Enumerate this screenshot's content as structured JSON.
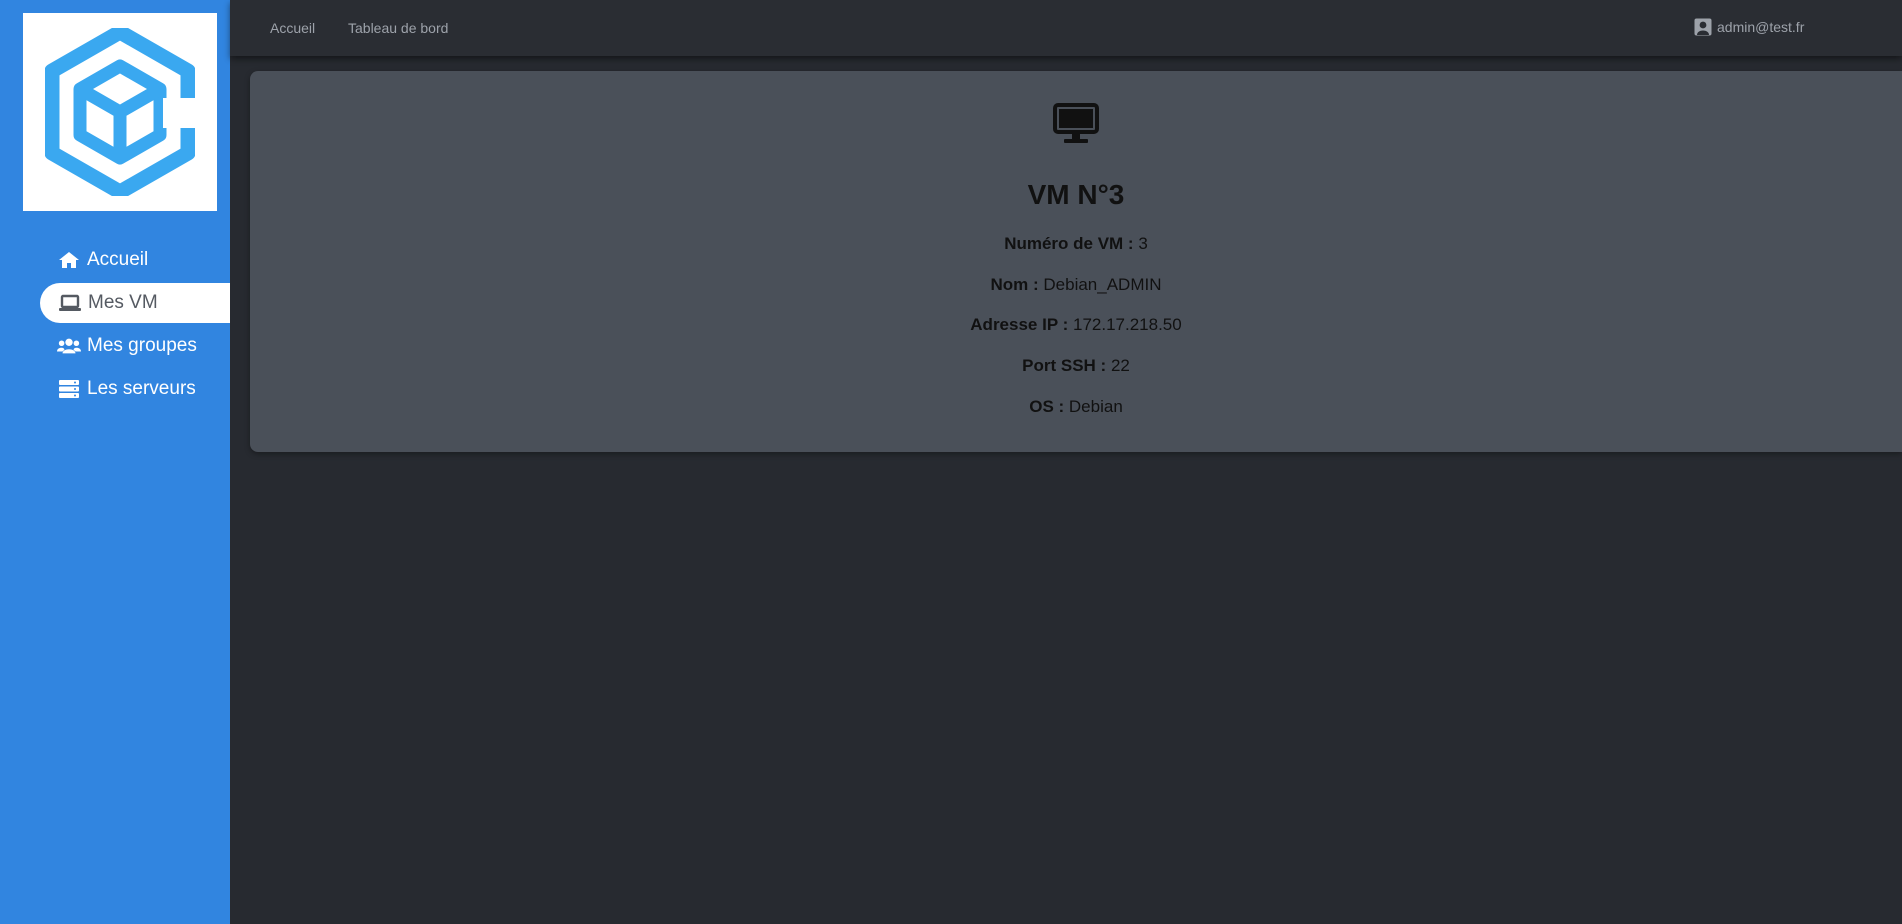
{
  "sidebar": {
    "logo": "cube-logo",
    "items": [
      {
        "label": "Accueil",
        "icon": "home-icon"
      },
      {
        "label": "Mes VM",
        "icon": "laptop-icon",
        "active": true
      },
      {
        "label": "Mes groupes",
        "icon": "users-icon"
      },
      {
        "label": "Les serveurs",
        "icon": "server-icon"
      }
    ]
  },
  "topbar": {
    "links": [
      "Accueil",
      "Tableau de bord"
    ],
    "user": "admin@test.fr"
  },
  "vm": {
    "icon": "desktop-icon",
    "title": "VM N°3",
    "fields": [
      {
        "label": "Numéro de VM :",
        "value": "3"
      },
      {
        "label": "Nom :",
        "value": "Debian_ADMIN"
      },
      {
        "label": "Adresse IP :",
        "value": "172.17.218.50"
      },
      {
        "label": "Port SSH :",
        "value": "22"
      },
      {
        "label": "OS :",
        "value": "Debian"
      }
    ]
  },
  "colors": {
    "sidebar": "#3185e0",
    "background": "#272a30",
    "card": "#4a5059",
    "logo_blue": "#3aa8f0"
  }
}
